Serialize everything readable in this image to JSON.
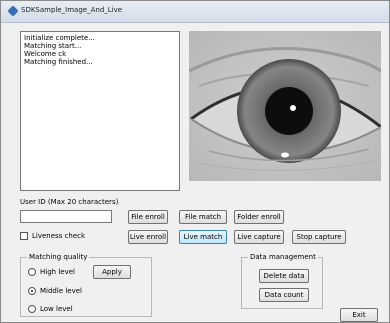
{
  "window": {
    "title": "SDKSample_Image_And_Live"
  },
  "log": {
    "lines": "Initialize complete...\nMatching start...\nWelcome ck\nMatching finished..."
  },
  "enroll": {
    "user_id_label": "User ID (Max 20 characters)",
    "user_id_value": "",
    "file_enroll": "File enroll",
    "file_match": "File match",
    "folder_enroll": "Folder enroll",
    "liveness_check": "Liveness check",
    "live_enroll": "Live enroll",
    "live_match": "Live match",
    "live_capture": "Live capture",
    "stop_capture": "Stop capture"
  },
  "matching_quality": {
    "legend": "Matching quality",
    "high": "High level",
    "middle": "Middle level",
    "low": "Low level",
    "apply": "Apply",
    "selected": "middle"
  },
  "data_management": {
    "legend": "Data management",
    "delete_data": "Delete data",
    "data_count": "Data count"
  },
  "exit": "Exit"
}
